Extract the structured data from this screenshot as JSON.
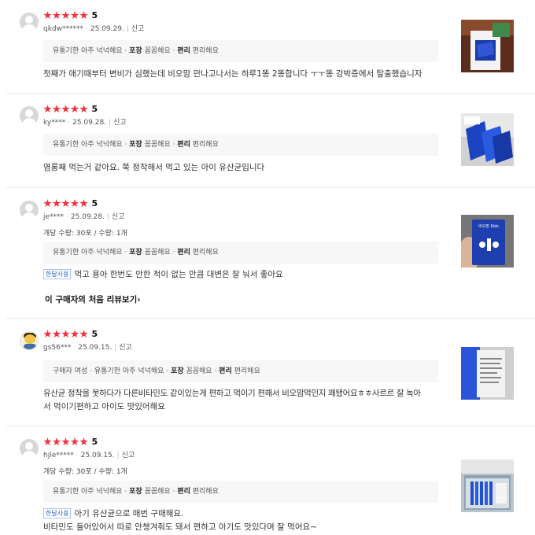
{
  "reviews": [
    {
      "score": "5",
      "user": "qkdw******",
      "date": "25.09.29.",
      "report": "신고",
      "option": "",
      "attrs": [
        {
          "name": "유통기한",
          "value": "아주 넉넉해요"
        },
        {
          "name": "포장",
          "value": "꼼꼼해요"
        },
        {
          "name": "편리",
          "value": "편리해요"
        }
      ],
      "badge": "",
      "lines": [
        "첫째가 애기때부터 변비가 심했는데 비오맘 만나고나서는 하루1똥 2똥합니다 ㅜㅜ똥 강박증에서 탈출했습니자"
      ]
    },
    {
      "score": "5",
      "user": "ky****",
      "date": "25.09.28.",
      "report": "신고",
      "option": "",
      "attrs": [
        {
          "name": "유통기한",
          "value": "아주 넉넉해요"
        },
        {
          "name": "포장",
          "value": "꼼꼼해요"
        },
        {
          "name": "편리",
          "value": "편리해요"
        }
      ],
      "badge": "",
      "lines": [
        "염롱째 먹는거 같아요. 쭉 정착해서 먹고 있는 아이 유산균입니다"
      ]
    },
    {
      "score": "5",
      "user": "je****",
      "date": "25.09.28.",
      "report": "신고",
      "option": "개당 수량: 30포 / 수량: 1개",
      "attrs": [
        {
          "name": "유통기한",
          "value": "아주 넉넉해요"
        },
        {
          "name": "포장",
          "value": "꼼꼼해요"
        },
        {
          "name": "편리",
          "value": "편리해요"
        }
      ],
      "badge": "한달사용",
      "lines": [
        "먹고 용아 한번도 안한 적이 없는 만큼 대변은 잘 눠서 좋아요"
      ],
      "more": "이 구매자의 처음 리뷰보기"
    },
    {
      "score": "5",
      "user": "gs56***",
      "date": "25.09.15.",
      "report": "신고",
      "option": "",
      "attrs": [
        {
          "name": "구매자",
          "value": "여성"
        },
        {
          "name": "유통기한",
          "value": "아주 넉넉해요"
        },
        {
          "name": "포장",
          "value": "꼼꼼해요"
        },
        {
          "name": "편리",
          "value": "편리해요"
        }
      ],
      "badge": "",
      "lines": [
        "유산균 정착을 못하다가 다른비타민도 같이있는게 편하고 먹이기 편해서 비오맘먹인지 꽤됐어요ㅎㅎ사르르 잘 녹아",
        "서 먹이기편하고 아이도 맛있어해요"
      ]
    },
    {
      "score": "5",
      "user": "hjle*****",
      "date": "25.09.15.",
      "report": "신고",
      "option": "개당 수량: 30포 / 수량: 1개",
      "attrs": [
        {
          "name": "유통기한",
          "value": "아주 넉넉해요"
        },
        {
          "name": "포장",
          "value": "꼼꼼해요"
        },
        {
          "name": "편리",
          "value": "편리해요"
        }
      ],
      "badge": "한달사용",
      "lines": [
        "아기 유산균으로 매번 구매해요.",
        "비타민도 들어있어서 따로 안챙겨줘도 돼서 편하고 아기도 맛있다며 잘 먹어요~"
      ]
    }
  ],
  "colors": {
    "star": "#f5303d",
    "badge": "#2b5fc1",
    "attr_bg": "#f7f7f7"
  }
}
